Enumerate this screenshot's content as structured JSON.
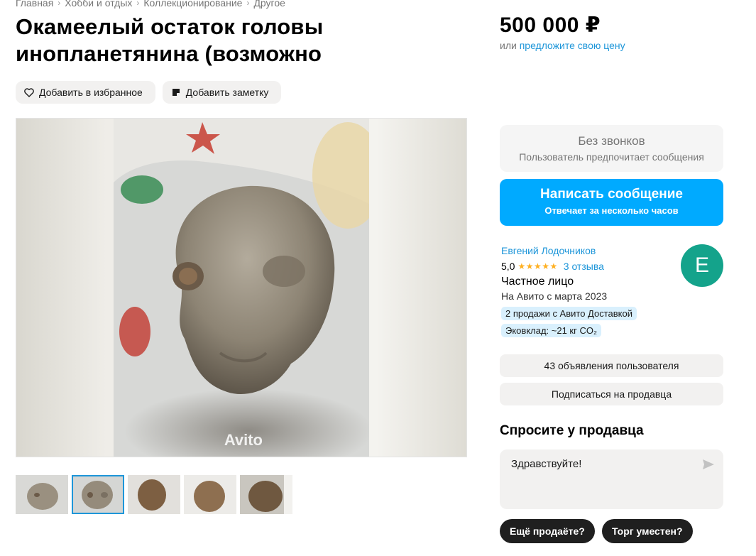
{
  "breadcrumbs": [
    "Главная",
    "Хобби и отдых",
    "Коллекционирование",
    "Другое"
  ],
  "title": "Окамеелый остаток головы инопланетянина (возможно",
  "price": "500 000 ₽",
  "offer_prefix": "или",
  "offer_link": "предложите свою цену",
  "actions": {
    "favorite": "Добавить в избранное",
    "note": "Добавить заметку"
  },
  "gallery": {
    "watermark": "Avito",
    "thumb_count": 5,
    "active_thumb": 1
  },
  "no_calls": {
    "title": "Без звонков",
    "subtitle": "Пользователь предпочитает сообщения"
  },
  "message_button": {
    "title": "Написать сообщение",
    "subtitle": "Отвечает за несколько часов"
  },
  "seller": {
    "name": "Евгений Лодочников",
    "rating": "5,0",
    "stars": "★★★★★",
    "reviews": "3 отзыва",
    "type": "Частное лицо",
    "since": "На Авито с марта 2023",
    "badge_delivery": "2 продажи с Авито Доставкой",
    "badge_eco": "Эковклад: ~21 кг CO₂",
    "avatar_letter": "Е",
    "avatar_color": "#14a38b"
  },
  "listings_button": "43 объявления пользователя",
  "subscribe_button": "Подписаться на продавца",
  "ask": {
    "title": "Спросите у продавца",
    "message": "Здравствуйте!",
    "quick_replies": [
      "Ещё продаёте?",
      "Торг уместен?"
    ]
  },
  "colors": {
    "link": "#1e96d9",
    "primary": "#00aaff",
    "star": "#ffb021"
  }
}
